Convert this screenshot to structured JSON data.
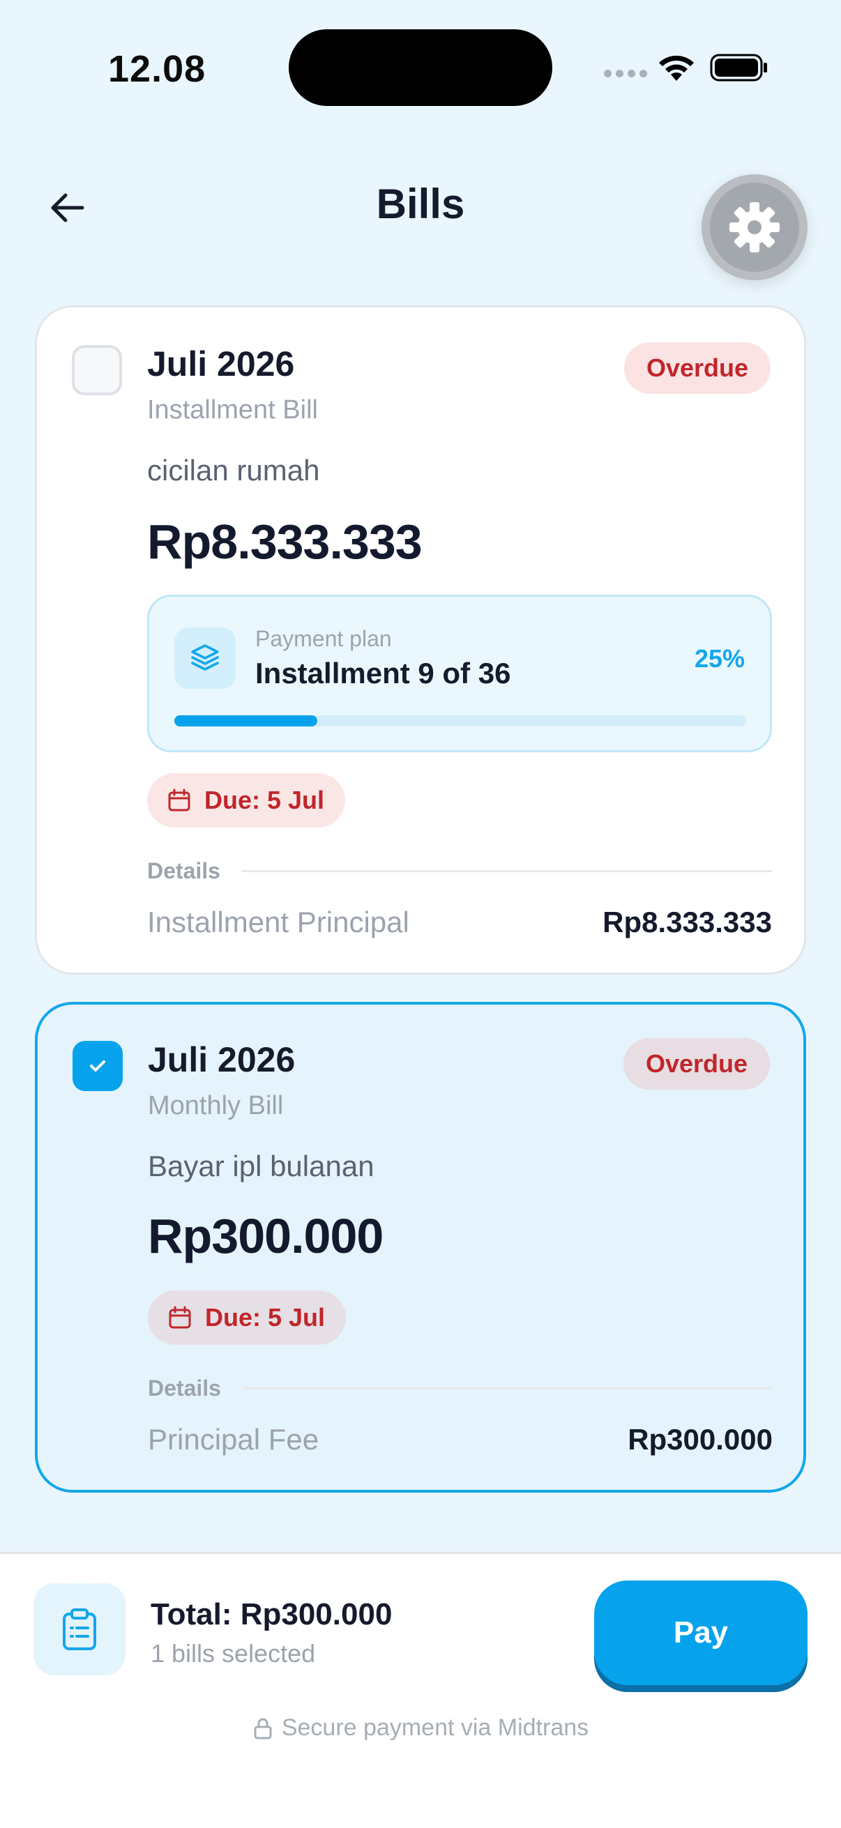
{
  "status_bar": {
    "time": "12.08"
  },
  "header": {
    "title": "Bills"
  },
  "bills": [
    {
      "month": "Juli 2026",
      "type": "Installment Bill",
      "status": "Overdue",
      "description": "cicilan rumah",
      "amount": "Rp8.333.333",
      "selected": false,
      "payment_plan": {
        "label": "Payment plan",
        "value": "Installment 9 of 36",
        "percent_label": "25%",
        "progress": 0.25
      },
      "due": "Due: 5 Jul",
      "details_label": "Details",
      "line_item": {
        "label": "Installment Principal",
        "value": "Rp8.333.333"
      }
    },
    {
      "month": "Juli 2026",
      "type": "Monthly Bill",
      "status": "Overdue",
      "description": "Bayar ipl bulanan",
      "amount": "Rp300.000",
      "selected": true,
      "due": "Due: 5 Jul",
      "details_label": "Details",
      "line_item": {
        "label": "Principal Fee",
        "value": "Rp300.000"
      }
    }
  ],
  "footer": {
    "total": "Total: Rp300.000",
    "selected_count": "1 bills selected",
    "pay_label": "Pay",
    "secure_note": "Secure payment via Midtrans"
  },
  "colors": {
    "accent": "#06A3EC",
    "overdue": "#C0262A",
    "background": "#EAF6FD"
  },
  "icons": {
    "back": "arrow-left-icon",
    "settings": "gear-icon",
    "plan": "layers-icon",
    "due": "calendar-icon",
    "footer": "clipboard-icon",
    "secure": "lock-icon",
    "check": "check-icon"
  }
}
